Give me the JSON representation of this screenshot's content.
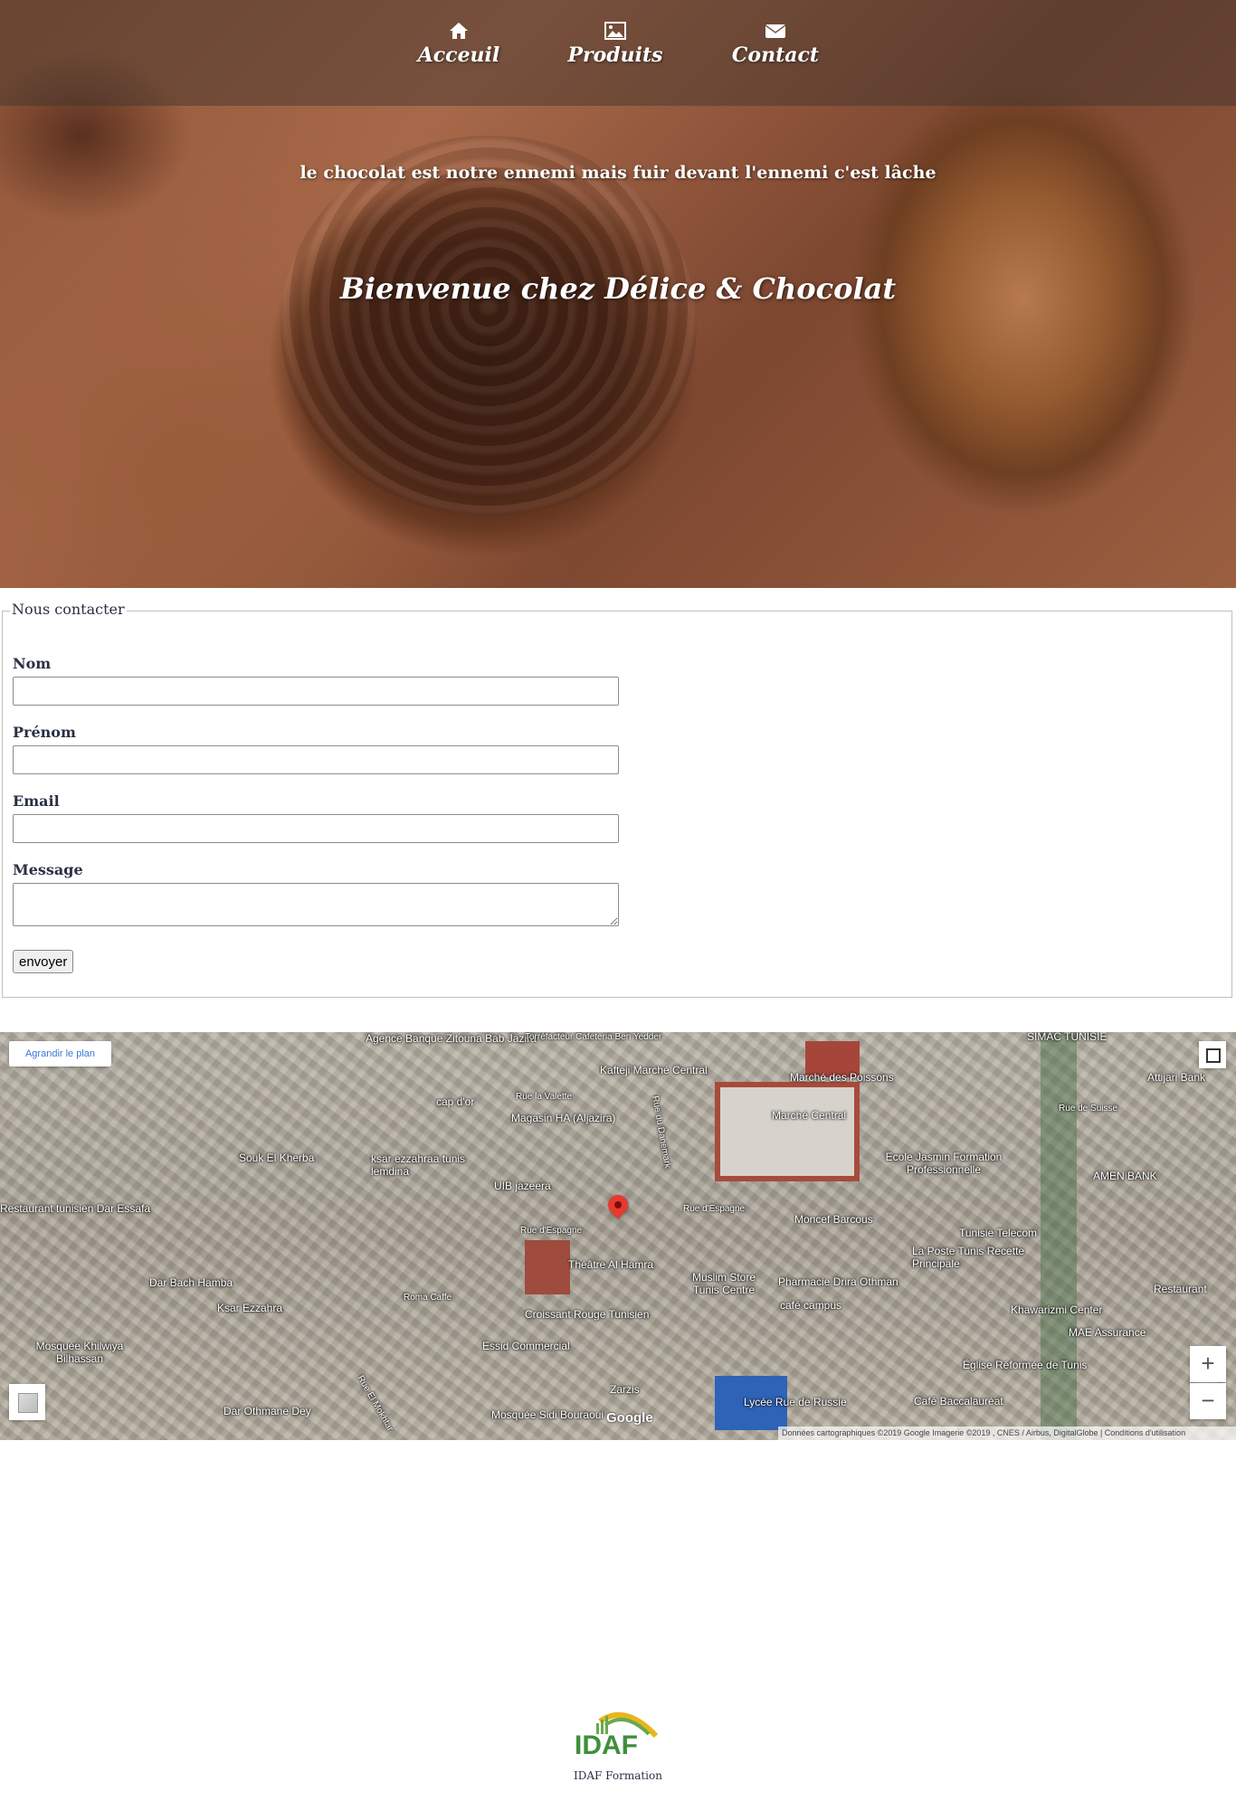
{
  "nav": {
    "items": [
      {
        "label": "Acceuil",
        "icon": "home-icon"
      },
      {
        "label": "Produits",
        "icon": "image-icon"
      },
      {
        "label": "Contact",
        "icon": "envelope-icon"
      }
    ]
  },
  "hero": {
    "tagline": "le chocolat est notre ennemi mais fuir devant l'ennemi c'est lâche",
    "welcome": "Bienvenue chez Délice & Chocolat"
  },
  "form": {
    "legend": "Nous contacter",
    "fields": [
      {
        "label": "Nom",
        "value": ""
      },
      {
        "label": "Prénom",
        "value": ""
      },
      {
        "label": "Email",
        "value": ""
      },
      {
        "label": "Message",
        "value": ""
      }
    ],
    "submit_label": "envoyer"
  },
  "map": {
    "enlarge_label": "Agrandir le plan",
    "zoom_in": "+",
    "zoom_out": "−",
    "attribution": "Données cartographiques ©2019 Google Imagerie ©2019 , CNES / Airbus, DigitalGlobe | Conditions d'utilisation",
    "google": "Google",
    "places": [
      "Agence Banque Zitouna Bab Jazira",
      "Torréfacteur Cafeteria Ben Yedder",
      "Kafteji Marché Central",
      "Marché des Poissons",
      "Marché Central",
      "SIMAC TUNISIE",
      "Attijari Bank",
      "Rue de Suisse",
      "cap d'or",
      "Rue la Valette",
      "Magasin HA (Aljazira)",
      "Souk El Kherba",
      "ksar ezzahraa tunis lemdina",
      "UIB jazeera",
      "Ecole Jasmin Formation Professionnelle",
      "AMEN BANK",
      "Restaurant tunisien Dar Essafa",
      "Rue d'Espagne",
      "Moncef Barcous",
      "Tunisie Telecom",
      "Rue d'Espagne",
      "Théâtre Al Hamra",
      "La Poste Tunis Recette Principale",
      "Dar Bach Hamba",
      "Roma Caffe",
      "Muslim Store Tunis Centre",
      "Pharmacie Drira Othman",
      "Restaurant",
      "Ksar Ezzahra",
      "Croissant Rouge Tunisien",
      "café campus",
      "Khawarizmi Center",
      "Mosquée Khilwiya Bilhassan",
      "Essid Commercial",
      "MAE Assurance",
      "Église Réformée de Tunis",
      "Zarzis",
      "Dar Othmane Dey",
      "Mosquée Sidi Bouraoui",
      "Lycée Rue de Russie",
      "Café Baccalauréat",
      "Rue El Mokhtar",
      "Rue du Danemark"
    ]
  },
  "footer": {
    "logo_text": "IDAF",
    "caption": "IDAF Formation"
  }
}
